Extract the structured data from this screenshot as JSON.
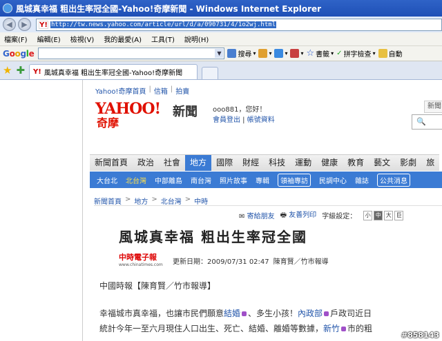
{
  "window": {
    "title": "風城真幸福 粗出生率冠全國-Yahoo!奇摩新聞 - Windows Internet Explorer"
  },
  "address": {
    "url": "http://tw.news.yahoo.com/article/url/d/a/090731/4/1o2wj.html"
  },
  "menu": [
    "檔案(F)",
    "編輯(E)",
    "檢視(V)",
    "我的最愛(A)",
    "工具(T)",
    "說明(H)"
  ],
  "google_toolbar": {
    "logo": "Google",
    "search_label": "搜尋",
    "bookmarks_label": "書籤",
    "spell_label": "拼字檢查",
    "autofill_label": "自動"
  },
  "tab": {
    "title": "風城真幸福 粗出生率冠全國-Yahoo!奇摩新聞"
  },
  "site": {
    "topnav": [
      "Yahoo!奇摩首頁",
      "信箱",
      "拍賣"
    ],
    "logo_text": "YAHOO!",
    "logo_sub": "奇摩",
    "section_title": "新聞",
    "user_greeting": "ooo881，您好！",
    "logout": "會員登出",
    "account": "帳號資料",
    "news_box": "新聞"
  },
  "categories": [
    "新聞首頁",
    "政治",
    "社會",
    "地方",
    "國際",
    "財經",
    "科技",
    "運動",
    "健康",
    "教育",
    "藝文",
    "影劇",
    "旅"
  ],
  "active_category": "地方",
  "subnav": [
    "大台北",
    "北台灣",
    "中部離島",
    "南台灣",
    "照片故事",
    "專輯",
    "領袖專訪",
    "民調中心",
    "雜誌",
    "公共消息"
  ],
  "breadcrumb": [
    "新聞首頁",
    "地方",
    "北台灣",
    "中時"
  ],
  "tools": {
    "send": "寄給朋友",
    "print": "友善列印",
    "font_label": "字級設定：",
    "sizes": [
      "小",
      "中",
      "大",
      "巨"
    ]
  },
  "article": {
    "headline": "風城真幸福 粗出生率冠全國",
    "source_logo": "中時電子報",
    "source_url": "www.chinatimes.com",
    "updated": "更新日期：2009/07/31 02:47",
    "author": "陳育賢／竹市報導",
    "byline": "中國時報【陳育賢／竹市報導】",
    "p1a": "幸福城市真幸福，也讓市民們願意",
    "p1k1": "結婚",
    "p1b": "、多生小孩！",
    "p1k2": "內政部",
    "p1c": "戶政司近日",
    "p2a": "統計今年一至六月現住人口出生、死亡、結婚、離婚等數據，",
    "p2k1": "新竹",
    "p2b": "市的粗"
  },
  "watermark": "#858143"
}
